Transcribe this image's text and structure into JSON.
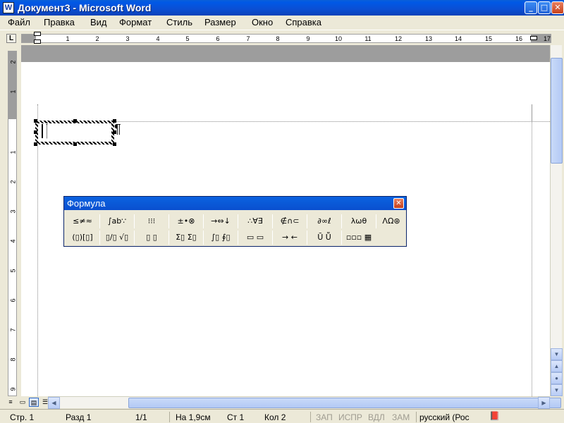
{
  "window": {
    "title": "Документ3 - Microsoft Word",
    "app_icon": "W"
  },
  "menu": [
    "Файл",
    "Правка",
    "Вид",
    "Формат",
    "Стиль",
    "Размер",
    "Окно",
    "Справка"
  ],
  "ruler": {
    "tab_selector": "L",
    "h_numbers": [
      "1",
      "2",
      "3",
      "4",
      "5",
      "6",
      "7",
      "8",
      "9",
      "10",
      "11",
      "12",
      "13",
      "14",
      "15",
      "16",
      "17"
    ],
    "v_numbers": [
      "2",
      "1",
      "1",
      "2",
      "3",
      "4",
      "5",
      "6",
      "7",
      "8",
      "9"
    ]
  },
  "equation_toolbar": {
    "title": "Формула",
    "row1": [
      "≤≠≈",
      "∫ab∵",
      "⁝⁝⁝",
      "±•⊗",
      "→⇔↓",
      "∴∀∃",
      "∉∩⊂",
      "∂∞ℓ",
      "λωθ",
      "ΛΩ⊛"
    ],
    "row2": [
      "(▯)[▯]",
      "▯/▯ √▯",
      "▯ ▯",
      "Σ▯ Σ▯",
      "∫▯ ∮▯",
      "▭ ▭",
      "→ ←",
      "Ū Ṻ",
      "▫▫▫ ▦"
    ]
  },
  "status": {
    "page": "Стр. 1",
    "section": "Разд 1",
    "pages": "1/1",
    "at": "На 1,9см",
    "line": "Ст 1",
    "col": "Кол 2",
    "rec": "ЗАП",
    "trk": "ИСПР",
    "ext": "ВДЛ",
    "ovr": "ЗАМ",
    "language": "русский (Рос"
  }
}
